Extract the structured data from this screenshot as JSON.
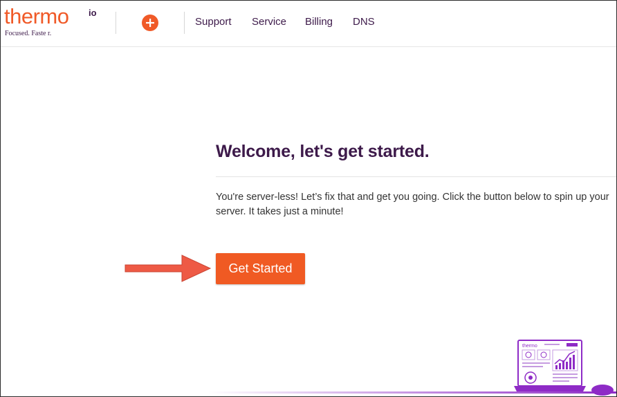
{
  "brand": {
    "name": "thermo",
    "superscript": "io",
    "tagline": "Focused.   Faste r."
  },
  "header": {
    "add_icon": "plus-circle-icon",
    "nav": [
      {
        "label": "Support"
      },
      {
        "label": "Service"
      },
      {
        "label": "Billing"
      },
      {
        "label": "DNS"
      }
    ]
  },
  "main": {
    "title": "Welcome, let's get started.",
    "intro": "You're server-less! Let’s fix that and get you going. Click the button below to spin up your\nserver. It takes just a minute!",
    "cta_label": "Get Started"
  },
  "annotation": {
    "icon": "red-arrow-right-icon"
  },
  "illustration": {
    "icon": "laptop-dashboard-illustration",
    "screen_logo": "thermo"
  },
  "colors": {
    "brand_orange": "#f05a28",
    "brand_purple": "#3d1a4a",
    "annotation_red": "#ee5a45",
    "illustration_purple": "#8e2bc6"
  }
}
